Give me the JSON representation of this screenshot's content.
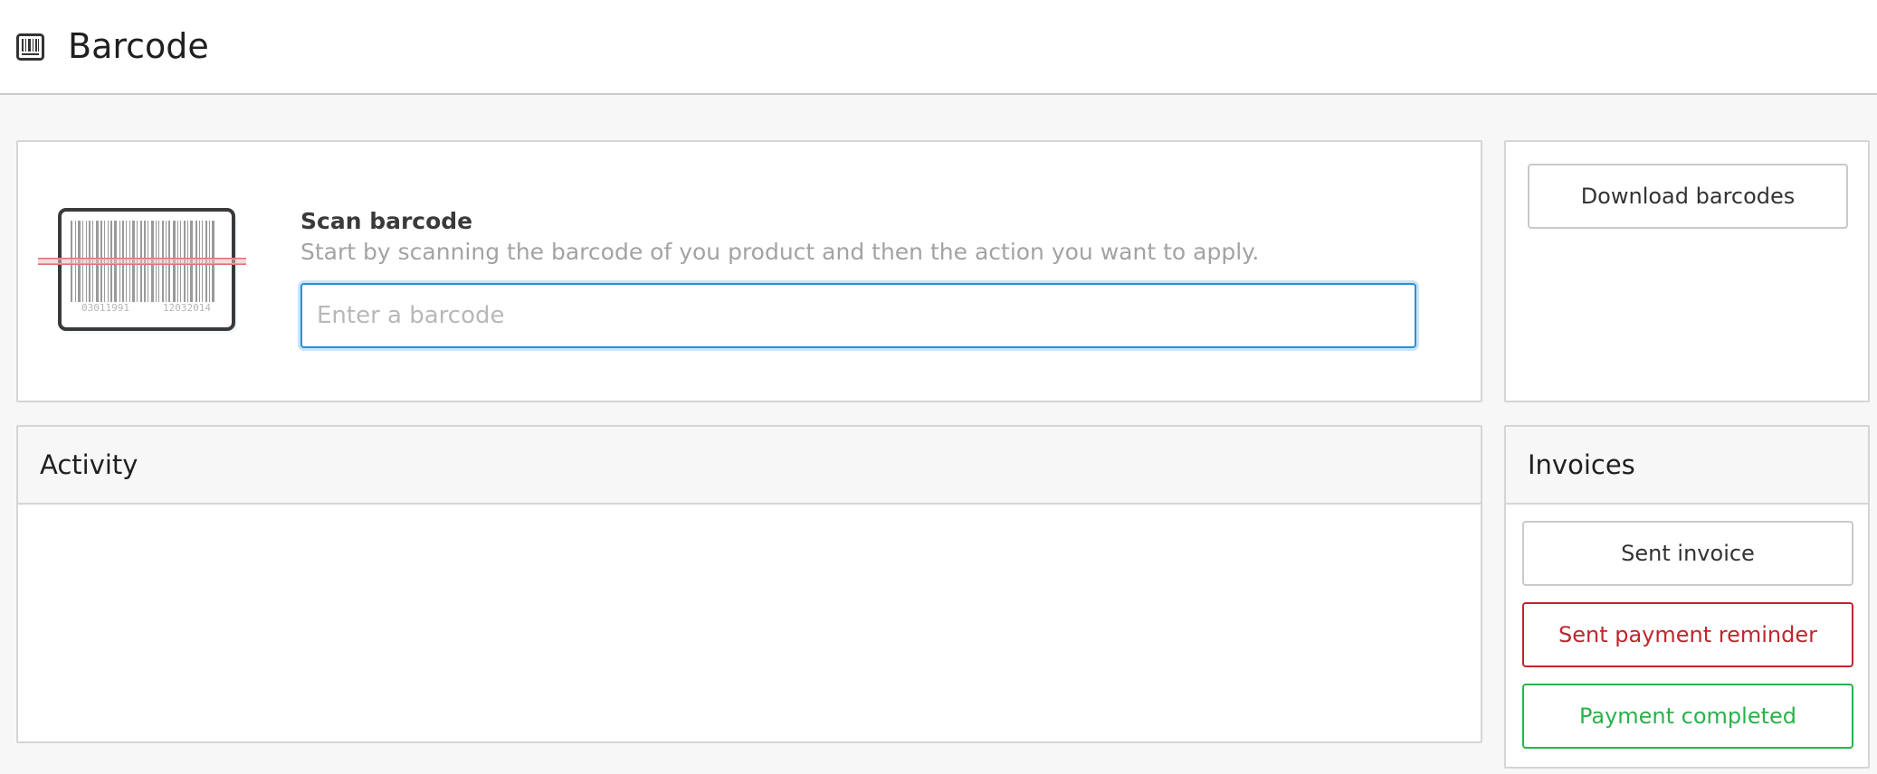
{
  "header": {
    "icon": "barcode-icon",
    "title": "Barcode"
  },
  "scan": {
    "illustration_icon": "barcode-scanner-icon",
    "barcode_digits_left": "03011991",
    "barcode_digits_right": "12032014",
    "title": "Scan barcode",
    "help_text": "Start by scanning the barcode of you product and then the action you want to apply.",
    "input_placeholder": "Enter a barcode",
    "input_value": ""
  },
  "actions": {
    "download_label": "Download barcodes"
  },
  "activity": {
    "heading": "Activity"
  },
  "invoices": {
    "heading": "Invoices",
    "sent_label": "Sent invoice",
    "reminder_label": "Sent payment reminder",
    "completed_label": "Payment completed"
  },
  "colors": {
    "input_focus_border": "#2a8fd6",
    "danger": "#c0262d",
    "success": "#2bb24c",
    "scan_line": "#e0737a"
  }
}
